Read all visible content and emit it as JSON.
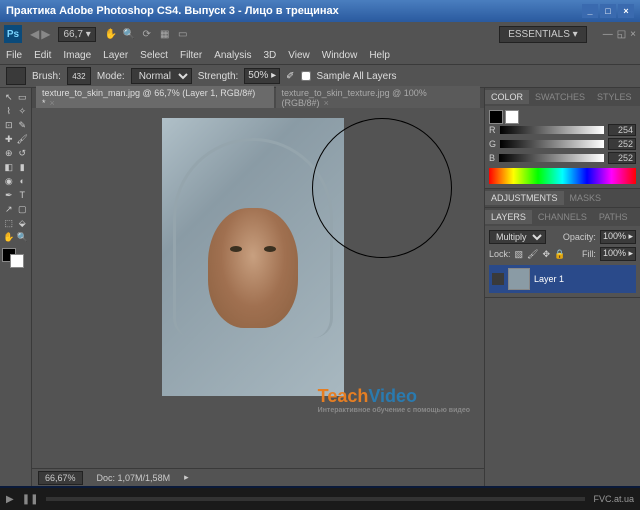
{
  "title": "Практика Adobe Photoshop CS4. Выпуск 3 - Лицо в трещинах",
  "ps_icon": "Ps",
  "top_zoom": "66,7",
  "essentials": "ESSENTIALS ▾",
  "menu": {
    "file": "File",
    "edit": "Edit",
    "image": "Image",
    "layer": "Layer",
    "select": "Select",
    "filter": "Filter",
    "analysis": "Analysis",
    "3d": "3D",
    "view": "View",
    "window": "Window",
    "help": "Help"
  },
  "optbar": {
    "brush_label": "Brush:",
    "brush_size": "432",
    "mode_label": "Mode:",
    "mode_value": "Normal",
    "strength_label": "Strength:",
    "strength_value": "50%",
    "sample_all": "Sample All Layers"
  },
  "tabs": {
    "tab1": "texture_to_skin_man.jpg @ 66,7% (Layer 1, RGB/8#) *",
    "tab2": "texture_to_skin_texture.jpg @ 100% (RGB/8#)"
  },
  "status": {
    "zoom": "66,67%",
    "doc": "Doc: 1,07M/1,58M"
  },
  "panels": {
    "color": {
      "tab1": "COLOR",
      "tab2": "SWATCHES",
      "tab3": "STYLES",
      "r": "R",
      "g": "G",
      "b": "B",
      "rval": "254",
      "gval": "252",
      "bval": "252"
    },
    "adjustments": {
      "tab1": "ADJUSTMENTS",
      "tab2": "MASKS"
    },
    "layers": {
      "tab1": "LAYERS",
      "tab2": "CHANNELS",
      "tab3": "PATHS",
      "blend": "Multiply",
      "opacity_label": "Opacity:",
      "opacity": "100%",
      "lock_label": "Lock:",
      "fill_label": "Fill:",
      "fill": "100%",
      "layer1": "Layer 1"
    }
  },
  "watermark": {
    "teach": "Teach",
    "video": "Video",
    "sub": "Интерактивное обучение с помощью видео"
  },
  "player": {
    "url": "FVC.at.ua"
  }
}
